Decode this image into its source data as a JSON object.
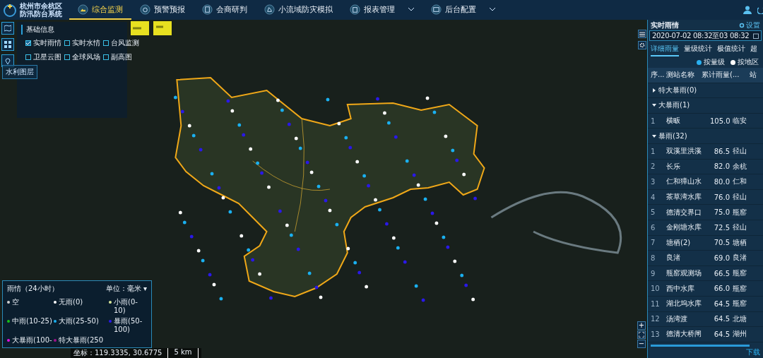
{
  "header": {
    "title_lines": [
      "杭州市余杭区",
      "防汛防台系统"
    ],
    "nav": [
      {
        "label": "综合监测",
        "selected": true,
        "dropdown": false
      },
      {
        "label": "预警预报",
        "selected": false,
        "dropdown": false
      },
      {
        "label": "会商研判",
        "selected": false,
        "dropdown": false
      },
      {
        "label": "小流域防灾模拟",
        "selected": false,
        "dropdown": false
      },
      {
        "label": "报表管理",
        "selected": false,
        "dropdown": true
      },
      {
        "label": "后台配置",
        "selected": false,
        "dropdown": true
      }
    ]
  },
  "layer_button": "水利图层",
  "info_panel": {
    "title": "基础信息",
    "options": [
      {
        "label": "实时雨情",
        "checked": true
      },
      {
        "label": "实时水情",
        "checked": false
      },
      {
        "label": "台风监测",
        "checked": false
      },
      {
        "label": "卫星云图",
        "checked": false
      },
      {
        "label": "全球风场",
        "checked": false
      },
      {
        "label": "副高图",
        "checked": false
      }
    ]
  },
  "legend": {
    "title": "雨情（24小时）",
    "unit": "单位：毫米",
    "unit_caret": "▾",
    "items": [
      {
        "label": "空",
        "color": "#d0d0d0"
      },
      {
        "label": "无雨(0)",
        "color": "#ffffff"
      },
      {
        "label": "小雨(0-10)",
        "color": "#d8e89a"
      },
      {
        "label": "中雨(10-25)",
        "color": "#18c018"
      },
      {
        "label": "大雨(25-50)",
        "color": "#1ab0f0"
      },
      {
        "label": "暴雨(50-100)",
        "color": "#2a18e8"
      },
      {
        "label": "大暴雨(100-",
        "color": "#e010e0"
      },
      {
        "label": "特大暴雨(250",
        "color": "#a0108a"
      }
    ]
  },
  "status_bar": {
    "coordinates": "坐标：119.3335, 30.6775",
    "scale": "5 km"
  },
  "map_controls": [
    "+",
    "−"
  ],
  "rain_panel": {
    "title": "实时雨情",
    "settings": "设置",
    "date_range": "2020-07-02 08:32至03 08:32",
    "tabs": [
      {
        "label": "详细雨量",
        "selected": true
      },
      {
        "label": "量级统计",
        "selected": false
      },
      {
        "label": "极值统计",
        "selected": false
      },
      {
        "label": "超",
        "selected": false
      }
    ],
    "modes": [
      {
        "label": "按量级",
        "selected": true
      },
      {
        "label": "按地区",
        "selected": false
      }
    ],
    "columns": [
      "序...",
      "测站名称",
      "累计雨量(...",
      "站"
    ],
    "groups": [
      {
        "label": "特大暴雨(0)",
        "expanded": false
      },
      {
        "label": "大暴雨(1)",
        "expanded": true,
        "rows": [
          [
            "1",
            "横畈",
            "105.0",
            "临安"
          ]
        ]
      },
      {
        "label": "暴雨(32)",
        "expanded": true,
        "rows": [
          [
            "1",
            "双溪里洪溪",
            "86.5",
            "径山"
          ],
          [
            "2",
            "长乐",
            "82.0",
            "余杭"
          ],
          [
            "3",
            "仁和獐山水",
            "80.0",
            "仁和"
          ],
          [
            "4",
            "茶草湾水库",
            "76.0",
            "径山"
          ],
          [
            "5",
            "德清交界口",
            "75.0",
            "瓶窑"
          ],
          [
            "6",
            "金刚塘水库",
            "72.5",
            "径山"
          ],
          [
            "7",
            "塘栖(2)",
            "70.5",
            "塘栖"
          ],
          [
            "8",
            "良渚",
            "69.0",
            "良渚"
          ],
          [
            "9",
            "瓶窑观测场",
            "66.5",
            "瓶窑"
          ],
          [
            "10",
            "西中水库",
            "66.0",
            "瓶窑"
          ],
          [
            "11",
            "湖北坞水库",
            "64.5",
            "瓶窑"
          ],
          [
            "12",
            "汤湾渡",
            "64.5",
            "北塘"
          ],
          [
            "13",
            "德清大桥闸",
            "64.5",
            "湖州"
          ]
        ]
      }
    ],
    "download": "下载"
  }
}
